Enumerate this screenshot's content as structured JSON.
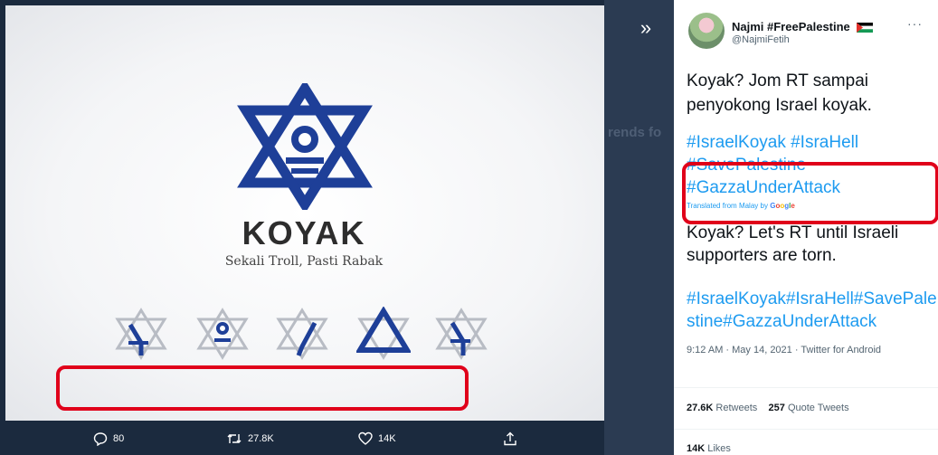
{
  "viewer": {
    "background_trends_heading": "rends fo",
    "image": {
      "brand_name": "KOYAK",
      "tagline": "Sekali Troll, Pasti Rabak"
    },
    "actions": {
      "reply_count": "80",
      "retweet_count": "27.8K",
      "like_count": "14K"
    }
  },
  "tweet": {
    "display_name": "Najmi #FreePalestine",
    "handle": "@NajmiFetih",
    "text": "Koyak? Jom RT sampai penyokong Israel koyak.",
    "hashtags_line1": "#IsraelKoyak #IsraHell",
    "hashtags_line2": "#SavePalestine",
    "hashtags_line3": "#GazzaUnderAttack",
    "translated_from": "Translated from Malay by",
    "translator_brand": [
      "G",
      "o",
      "o",
      "g",
      "l",
      "e"
    ],
    "translation": "Koyak? Let's RT until Israeli supporters are torn.",
    "translated_hashtags": "#IsraelKoyak#IsraHell#SavePalestine#GazzaUnderAttack",
    "timestamp": "9:12 AM · May 14, 2021 · Twitter for Android",
    "retweets_count": "27.6K",
    "retweets_label": "Retweets",
    "quote_count": "257",
    "quote_label": "Quote Tweets",
    "likes_count": "14K",
    "likes_label": "Likes"
  },
  "colors": {
    "logo_blue": "#1e3f98",
    "hashtag_blue": "#1d9bf0",
    "highlight_red": "#e0001a"
  }
}
